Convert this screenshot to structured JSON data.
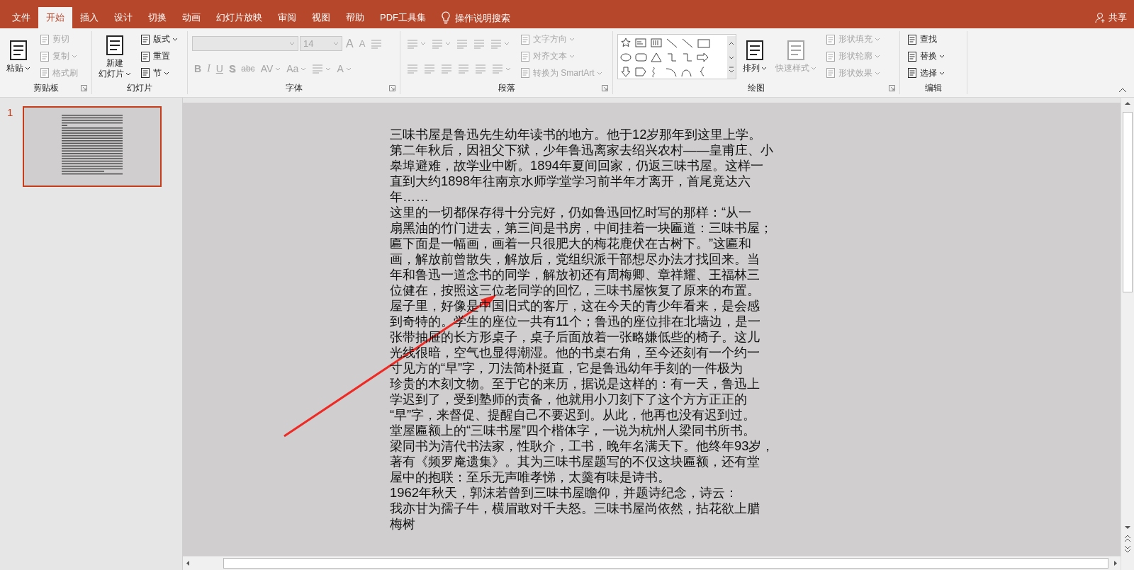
{
  "tabs": [
    {
      "label": "文件",
      "selected": false
    },
    {
      "label": "开始",
      "selected": true
    },
    {
      "label": "插入",
      "selected": false
    },
    {
      "label": "设计",
      "selected": false
    },
    {
      "label": "切换",
      "selected": false
    },
    {
      "label": "动画",
      "selected": false
    },
    {
      "label": "幻灯片放映",
      "selected": false
    },
    {
      "label": "审阅",
      "selected": false
    },
    {
      "label": "视图",
      "selected": false
    },
    {
      "label": "帮助",
      "selected": false
    },
    {
      "label": "PDF工具集",
      "selected": false
    }
  ],
  "tell_me_search": {
    "placeholder": "操作说明搜索"
  },
  "share_button": "共享",
  "ribbon": {
    "groups": [
      {
        "label": "剪贴板",
        "launcher": true,
        "columns": [
          [
            {
              "kind": "large",
              "label": [
                "粘贴"
              ],
              "dropdown": true,
              "disabled": false
            }
          ],
          [
            {
              "kind": "small",
              "label": "剪切",
              "dropdown": false,
              "disabled": true
            },
            {
              "kind": "small",
              "label": "复制",
              "dropdown": true,
              "disabled": true
            },
            {
              "kind": "small",
              "label": "格式刷",
              "dropdown": false,
              "disabled": true
            }
          ]
        ]
      },
      {
        "label": "幻灯片",
        "launcher": false,
        "columns": [
          [
            {
              "kind": "large",
              "label": [
                "新建",
                "幻灯片"
              ],
              "dropdown": true,
              "disabled": false
            }
          ],
          [
            {
              "kind": "small",
              "label": "版式",
              "dropdown": true,
              "disabled": false
            },
            {
              "kind": "small",
              "label": "重置",
              "dropdown": false,
              "disabled": false
            },
            {
              "kind": "small",
              "label": "节",
              "dropdown": true,
              "disabled": false
            }
          ]
        ]
      },
      {
        "label": "字体",
        "launcher": true,
        "columns": [
          [
            {
              "kind": "row",
              "items": [
                {
                  "kind": "field",
                  "dropdown": true,
                  "disabled": true
                },
                {
                  "kind": "field",
                  "value": "14",
                  "dropdown": true,
                  "disabled": true
                },
                {
                  "kind": "grow",
                  "label": "A",
                  "dropdown": false,
                  "disabled": true
                },
                {
                  "kind": "shrink",
                  "label": "A",
                  "dropdown": false,
                  "disabled": true
                },
                {
                  "kind": "icon",
                  "dropdown": false,
                  "disabled": true
                }
              ]
            },
            {
              "kind": "row",
              "items": [
                {
                  "kind": "bold",
                  "label": "B",
                  "dropdown": false,
                  "disabled": true
                },
                {
                  "kind": "italic",
                  "label": "I",
                  "dropdown": false,
                  "disabled": true
                },
                {
                  "kind": "underline",
                  "label": "U",
                  "dropdown": false,
                  "disabled": true
                },
                {
                  "kind": "shadow",
                  "label": "S",
                  "dropdown": false,
                  "disabled": true
                },
                {
                  "kind": "strike",
                  "label": "abc",
                  "dropdown": false,
                  "disabled": true
                },
                {
                  "kind": "glyph",
                  "label": "AV",
                  "dropdown": true,
                  "disabled": true
                },
                {
                  "kind": "glyph",
                  "label": "Aa",
                  "dropdown": true,
                  "disabled": true
                },
                {
                  "kind": "icon",
                  "dropdown": true,
                  "disabled": true
                },
                {
                  "kind": "glyph",
                  "label": "A",
                  "dropdown": true,
                  "disabled": true
                }
              ]
            }
          ]
        ]
      },
      {
        "label": "段落",
        "launcher": true,
        "columns": [
          [
            {
              "kind": "row",
              "items": [
                {
                  "kind": "icon",
                  "dropdown": true,
                  "disabled": true
                },
                {
                  "kind": "icon",
                  "dropdown": true,
                  "disabled": true
                },
                {
                  "kind": "icon",
                  "dropdown": false,
                  "disabled": true
                },
                {
                  "kind": "icon",
                  "dropdown": false,
                  "disabled": true
                },
                {
                  "kind": "icon",
                  "dropdown": true,
                  "disabled": true
                }
              ]
            },
            {
              "kind": "row",
              "items": [
                {
                  "kind": "icon",
                  "dropdown": false,
                  "disabled": true
                },
                {
                  "kind": "icon",
                  "dropdown": false,
                  "disabled": true
                },
                {
                  "kind": "icon",
                  "dropdown": false,
                  "disabled": true
                },
                {
                  "kind": "icon",
                  "dropdown": false,
                  "disabled": true
                },
                {
                  "kind": "icon",
                  "dropdown": false,
                  "disabled": true
                },
                {
                  "kind": "icon",
                  "dropdown": true,
                  "disabled": true
                }
              ]
            }
          ],
          [
            {
              "kind": "small",
              "label": "文字方向",
              "dropdown": true,
              "disabled": true
            },
            {
              "kind": "small",
              "label": "对齐文本",
              "dropdown": true,
              "disabled": true
            },
            {
              "kind": "small",
              "label": "转换为 SmartArt",
              "dropdown": true,
              "disabled": true
            }
          ]
        ]
      },
      {
        "label": "绘图",
        "launcher": true,
        "columns": [
          [
            {
              "kind": "gallery"
            }
          ],
          [
            {
              "kind": "large",
              "label": [
                "排列"
              ],
              "dropdown": true,
              "disabled": false
            }
          ],
          [
            {
              "kind": "large",
              "label": [
                "快速样式"
              ],
              "dropdown": true,
              "disabled": true
            }
          ],
          [
            {
              "kind": "small",
              "label": "形状填充",
              "dropdown": true,
              "disabled": true
            },
            {
              "kind": "small",
              "label": "形状轮廓",
              "dropdown": true,
              "disabled": true
            },
            {
              "kind": "small",
              "label": "形状效果",
              "dropdown": true,
              "disabled": true
            }
          ]
        ]
      },
      {
        "label": "编辑",
        "launcher": false,
        "columns": [
          [
            {
              "kind": "small",
              "label": "查找",
              "dropdown": false,
              "disabled": false
            },
            {
              "kind": "small",
              "label": "替换",
              "dropdown": true,
              "disabled": false
            },
            {
              "kind": "small",
              "label": "选择",
              "dropdown": true,
              "disabled": false
            }
          ]
        ]
      }
    ]
  },
  "slides_pane": {
    "thumbnails": [
      {
        "number": "1",
        "selected": true
      }
    ]
  },
  "slide": {
    "lines": [
      "三味书屋是鲁迅先生幼年读书的地方。他于12岁那年到这里上学。",
      "第二年秋后，因祖父下狱，少年鲁迅离家去绍兴农村——皇甫庄、小",
      "皋埠避难，故学业中断。1894年夏间回家，仍返三味书屋。这样一",
      "直到大约1898年往南京水师学堂学习前半年才离开，首尾竟达六",
      "年……",
      "这里的一切都保存得十分完好，仍如鲁迅回忆时写的那样：“从一",
      "扇黑油的竹门进去，第三间是书房，中间挂着一块匾道：三味书屋；",
      "匾下面是一幅画，画着一只很肥大的梅花鹿伏在古树下。”这匾和",
      "画，解放前曾散失，解放后，党组织派干部想尽办法才找回来。当",
      "年和鲁迅一道念书的同学，解放初还有周梅卿、章祥耀、王福林三",
      "位健在，按照这三位老同学的回忆，三味书屋恢复了原来的布置。",
      "屋子里，好像是中国旧式的客厅，这在今天的青少年看来，是会感",
      "到奇特的。学生的座位一共有11个；鲁迅的座位排在北墙边，是一",
      "张带抽屉的长方形桌子，桌子后面放着一张略嫌低些的椅子。这儿",
      "光线很暗，空气也显得潮湿。他的书桌右角，至今还刻有一个约一",
      "寸见方的“早”字，刀法简朴挺直，它是鲁迅幼年手刻的一件极为",
      "珍贵的木刻文物。至于它的来历，据说是这样的：有一天，鲁迅上",
      "学迟到了，受到塾师的责备，他就用小刀刻下了这个方方正正的",
      "“早”字，来督促、提醒自己不要迟到。从此，他再也没有迟到过。",
      "堂屋匾额上的“三味书屋”四个楷体字，一说为杭州人梁同书所书。",
      "梁同书为清代书法家，性耿介，工书，晚年名满天下。他终年93岁，",
      "著有《频罗庵遗集》。其为三味书屋题写的不仅这块匾额，还有堂",
      "屋中的抱联：至乐无声唯孝悌，太羹有味是诗书。",
      "1962年秋天，郭沫若曾到三味书屋瞻仰，并题诗纪念，诗云：",
      "我亦甘为孺子牛，横眉敢对千夫怒。三味书屋尚依然，拈花欲上腊",
      "梅树"
    ]
  }
}
